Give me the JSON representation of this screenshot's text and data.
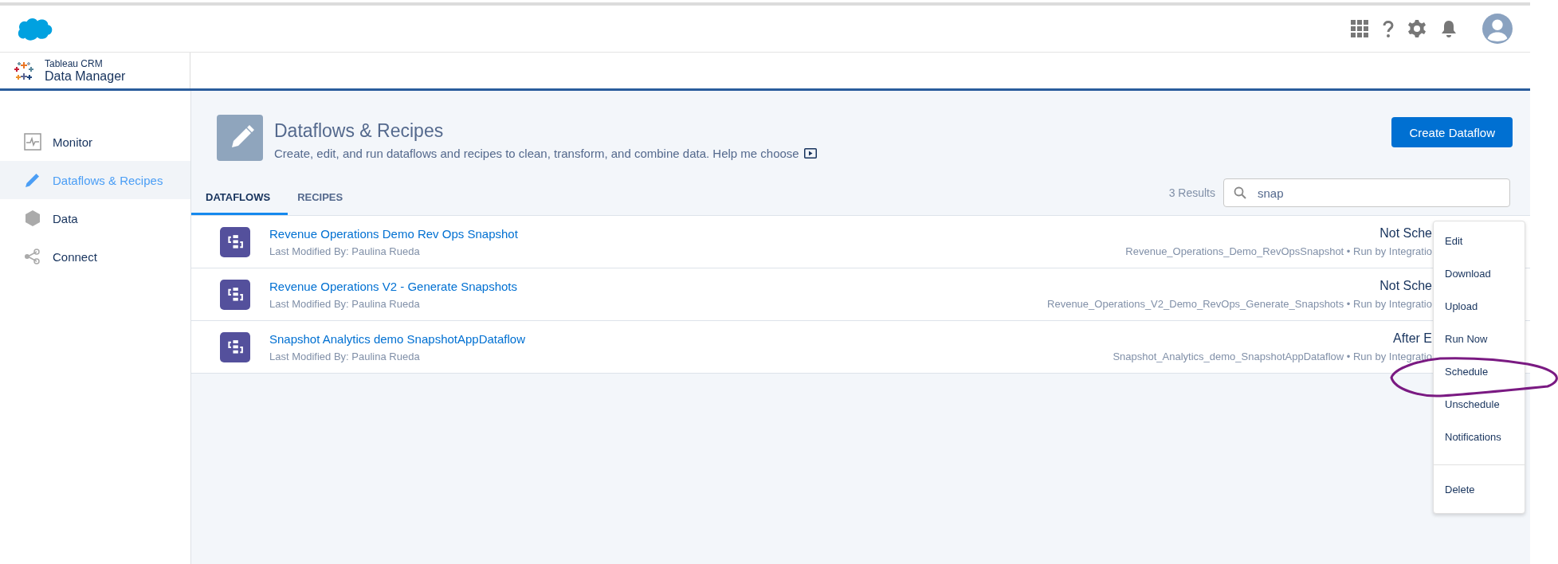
{
  "app": {
    "product": "Tableau CRM",
    "name": "Data Manager"
  },
  "sidebar": {
    "items": [
      {
        "label": "Monitor",
        "selected": false
      },
      {
        "label": "Dataflows & Recipes",
        "selected": true
      },
      {
        "label": "Data",
        "selected": false
      },
      {
        "label": "Connect",
        "selected": false
      }
    ]
  },
  "page": {
    "title": "Dataflows & Recipes",
    "subtitle": "Create, edit, and run dataflows and recipes to clean, transform, and combine data. Help me choose",
    "create_button": "Create Dataflow"
  },
  "tabs": [
    {
      "label": "DATAFLOWS",
      "selected": true
    },
    {
      "label": "RECIPES",
      "selected": false
    }
  ],
  "results": "3 Results",
  "search": {
    "value": "snap"
  },
  "rows": [
    {
      "title": "Revenue Operations Demo Rev Ops Snapshot",
      "modified": "Last Modified By: Paulina Rueda",
      "status": "Not Sche",
      "meta": "Revenue_Operations_Demo_RevOpsSnapshot • Run by Integratio"
    },
    {
      "title": "Revenue Operations V2 - Generate Snapshots",
      "modified": "Last Modified By: Paulina Rueda",
      "status": "Not Sche",
      "meta": "Revenue_Operations_V2_Demo_RevOps_Generate_Snapshots • Run by Integratio"
    },
    {
      "title": "Snapshot Analytics demo SnapshotAppDataflow",
      "modified": "Last Modified By: Paulina Rueda",
      "status": "After E",
      "meta": "Snapshot_Analytics_demo_SnapshotAppDataflow • Run by Integratio"
    }
  ],
  "menu": [
    {
      "label": "Edit",
      "divider_before": false
    },
    {
      "label": "Download",
      "divider_before": false
    },
    {
      "label": "Upload",
      "divider_before": false
    },
    {
      "label": "Run Now",
      "divider_before": false
    },
    {
      "label": "Schedule",
      "divider_before": false
    },
    {
      "label": "Unschedule",
      "divider_before": false
    },
    {
      "label": "Notifications",
      "divider_before": false
    },
    {
      "label": "Delete",
      "divider_before": true
    }
  ]
}
